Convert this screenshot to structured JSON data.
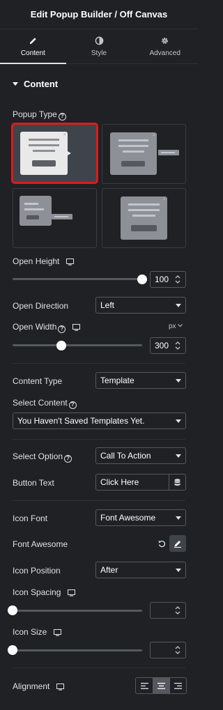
{
  "header": {
    "title": "Edit Popup Builder / Off Canvas"
  },
  "tabs": [
    {
      "label": "Content",
      "icon": "pencil-icon",
      "active": true
    },
    {
      "label": "Style",
      "icon": "contrast-icon",
      "active": false
    },
    {
      "label": "Advanced",
      "icon": "gear-icon",
      "active": false
    }
  ],
  "section": {
    "title": "Content"
  },
  "popup_type": {
    "label": "Popup Type"
  },
  "open_height": {
    "label": "Open Height",
    "value": "100"
  },
  "open_direction": {
    "label": "Open Direction",
    "value": "Left"
  },
  "open_width": {
    "label": "Open Width",
    "unit": "px",
    "value": "300"
  },
  "content_type": {
    "label": "Content Type",
    "value": "Template"
  },
  "select_content": {
    "label": "Select Content",
    "value": "You Haven't Saved Templates Yet."
  },
  "select_option": {
    "label": "Select Option",
    "value": "Call To Action"
  },
  "button_text": {
    "label": "Button Text",
    "value": "Click Here"
  },
  "icon_font": {
    "label": "Icon Font",
    "value": "Font Awesome"
  },
  "font_awesome": {
    "label": "Font Awesome"
  },
  "icon_position": {
    "label": "Icon Position",
    "value": "After"
  },
  "icon_spacing": {
    "label": "Icon Spacing",
    "value": ""
  },
  "icon_size": {
    "label": "Icon Size",
    "value": ""
  },
  "alignment": {
    "label": "Alignment",
    "selected": "center"
  },
  "colors": {
    "background": "#1f2124",
    "border": "#55595f",
    "selected_outline": "#e0191a",
    "text": "#e0e1e3"
  }
}
